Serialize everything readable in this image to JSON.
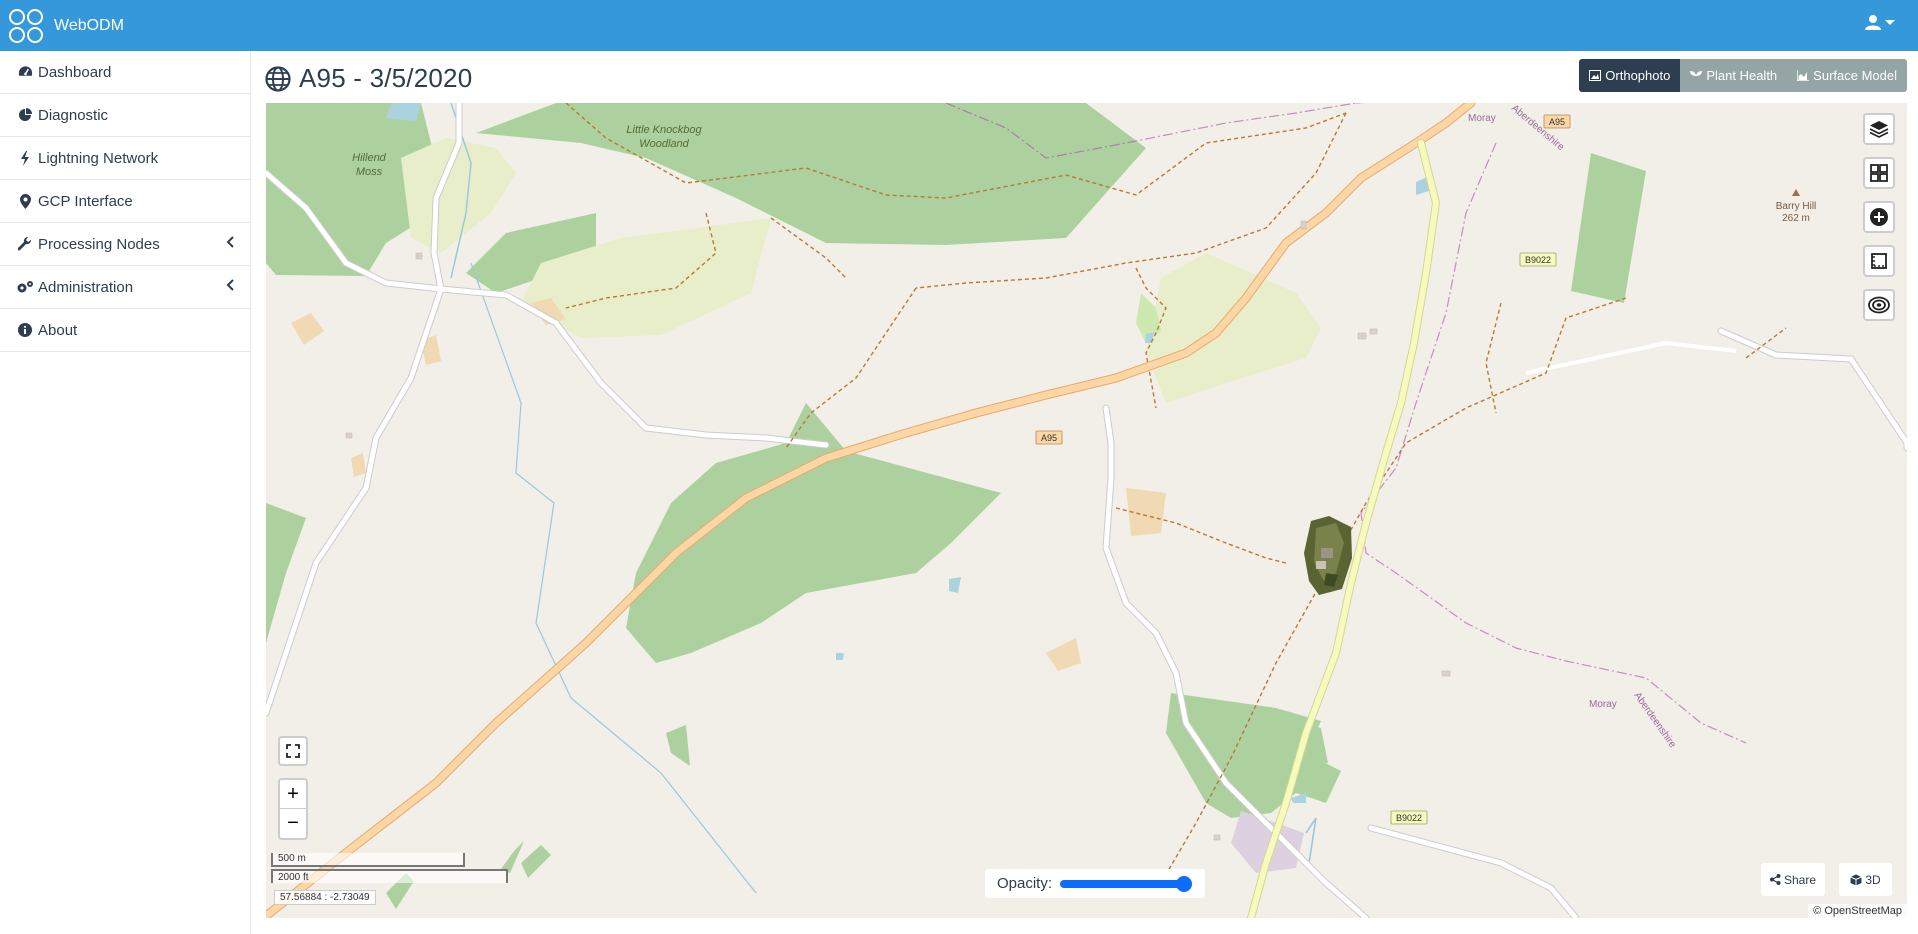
{
  "app": {
    "name": "WebODM"
  },
  "sidebar": {
    "items": [
      {
        "label": "Dashboard",
        "icon": "dashboard-icon"
      },
      {
        "label": "Diagnostic",
        "icon": "pie-chart-icon"
      },
      {
        "label": "Lightning Network",
        "icon": "bolt-icon"
      },
      {
        "label": "GCP Interface",
        "icon": "map-marker-icon"
      },
      {
        "label": "Processing Nodes",
        "icon": "wrench-icon",
        "has_caret": true
      },
      {
        "label": "Administration",
        "icon": "cogs-icon",
        "has_caret": true
      },
      {
        "label": "About",
        "icon": "info-icon"
      }
    ]
  },
  "page": {
    "title": "A95 - 3/5/2020"
  },
  "toolbar": {
    "orthophoto": "Orthophoto",
    "plant_health": "Plant Health",
    "surface_model": "Surface Model",
    "active": "orthophoto"
  },
  "map": {
    "labels": {
      "hillend_1": "Hillend",
      "hillend_2": "Moss",
      "knockbog_1": "Little Knockbog",
      "knockbog_2": "Woodland",
      "barry_1": "Barry Hill",
      "barry_2": "262 m",
      "moray_top": "Moray",
      "aberdeenshire_top": "Aberdeenshire",
      "moray_bottom": "Moray",
      "aberdeenshire_bottom": "Aberdeenshire",
      "a95_top": "A95",
      "a95_mid": "A95",
      "b9022_top": "B9022",
      "b9022_bottom": "B9022"
    },
    "scale_metric": "500 m",
    "scale_imperial": "2000 ft",
    "coordinates": "57.56884 : -2.73049",
    "opacity_label": "Opacity:",
    "opacity_value": 1.0,
    "share_label": "Share",
    "three_d_label": "3D",
    "attribution": "© OpenStreetMap",
    "zoom_in": "+",
    "zoom_out": "−"
  },
  "colors": {
    "topbar": "#3498db",
    "primary_road": "#fcd6a4",
    "secondary_road": "#f7fabf",
    "forest": "#add19e",
    "water": "#aad3df",
    "land": "#f2efe9",
    "active_button": "#2c3e50",
    "inactive_button": "#95a5a6"
  }
}
